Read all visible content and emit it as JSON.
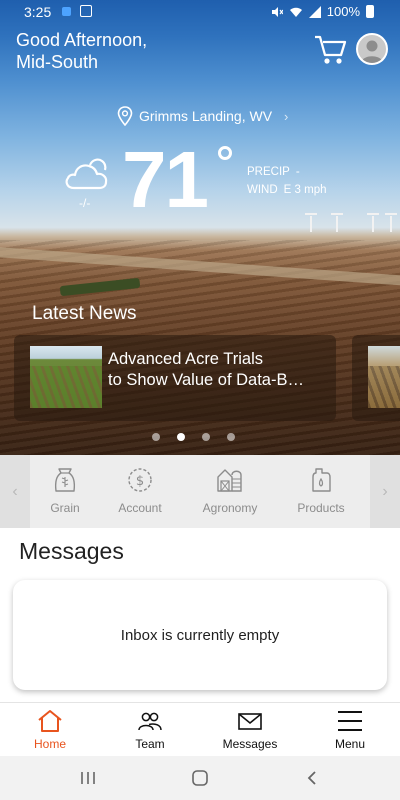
{
  "status_bar": {
    "time": "3:25",
    "battery": "100%"
  },
  "header": {
    "greeting_line1": "Good Afternoon,",
    "greeting_line2": "Mid-South",
    "cart_icon": "shopping-cart-icon",
    "avatar_icon": "user-avatar-icon"
  },
  "weather": {
    "location": "Grimms Landing, WV",
    "condition_icon": "cloud-icon",
    "condition": "-/-",
    "temperature": "71",
    "precip_label": "PRECIP",
    "precip_value": "-",
    "wind_label": "WIND",
    "wind_value": "E 3 mph"
  },
  "news": {
    "title": "Latest News",
    "items": [
      {
        "headline_line1": "Advanced Acre Trials",
        "headline_line2": "to Show Value of Data-B…"
      }
    ],
    "pages": 4,
    "active_page": 2
  },
  "categories": [
    {
      "label": "Grain",
      "icon": "grain-bag-icon"
    },
    {
      "label": "Account",
      "icon": "dollar-icon"
    },
    {
      "label": "Agronomy",
      "icon": "barn-icon"
    },
    {
      "label": "Products",
      "icon": "jug-icon"
    }
  ],
  "messages": {
    "title": "Messages",
    "empty_text": "Inbox is currently empty"
  },
  "bottom_nav": [
    {
      "label": "Home",
      "icon": "home-icon",
      "active": true
    },
    {
      "label": "Team",
      "icon": "team-icon",
      "active": false
    },
    {
      "label": "Messages",
      "icon": "envelope-icon",
      "active": false
    },
    {
      "label": "Menu",
      "icon": "menu-icon",
      "active": false
    }
  ],
  "colors": {
    "accent": "#e8541e",
    "sky_top": "#1f5fae",
    "soil": "#5b371f"
  }
}
